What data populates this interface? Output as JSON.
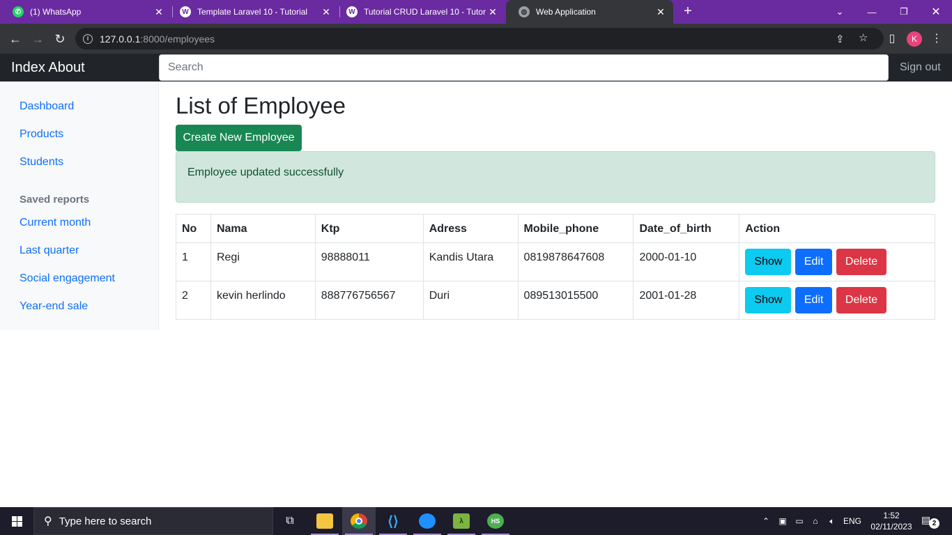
{
  "browser": {
    "tabs": [
      {
        "title": "(1) WhatsApp",
        "icon": "whatsapp-icon",
        "color": "#25d366"
      },
      {
        "title": "Template Laravel 10 - Tutorial",
        "icon": "wordpress-icon",
        "color": "#ffffff"
      },
      {
        "title": "Tutorial CRUD Laravel 10 - Tutor",
        "icon": "wordpress-icon",
        "color": "#ffffff"
      },
      {
        "title": "Web Application",
        "icon": "globe-icon",
        "color": "#9aa0a6",
        "active": true
      }
    ],
    "url_host": "127.0.0.1",
    "url_path": ":8000/employees",
    "profile_initial": "K",
    "tab_strip_color": "#6a2aa0"
  },
  "navbar": {
    "brand": "Index About",
    "search_placeholder": "Search",
    "sign_out": "Sign out"
  },
  "sidebar": {
    "items": [
      "Dashboard",
      "Products",
      "Students"
    ],
    "saved_reports_heading": "Saved reports",
    "reports": [
      "Current month",
      "Last quarter",
      "Social engagement",
      "Year-end sale"
    ]
  },
  "main": {
    "title": "List of Employee",
    "create_button": "Create New Employee",
    "alert": "Employee updated successfully",
    "table": {
      "headers": [
        "No",
        "Nama",
        "Ktp",
        "Adress",
        "Mobile_phone",
        "Date_of_birth",
        "Action"
      ],
      "rows": [
        {
          "no": "1",
          "nama": "Regi",
          "ktp": "98888011",
          "adress": "Kandis Utara",
          "mobile_phone": "0819878647608",
          "date_of_birth": "2000-01-10"
        },
        {
          "no": "2",
          "nama": "kevin herlindo",
          "ktp": "888776756567",
          "adress": "Duri",
          "mobile_phone": "089513015500",
          "date_of_birth": "2001-01-28"
        }
      ],
      "actions": {
        "show": "Show",
        "edit": "Edit",
        "delete": "Delete"
      }
    }
  },
  "taskbar": {
    "search_placeholder": "Type here to search",
    "language": "ENG",
    "time": "1:52",
    "date": "02/11/2023",
    "notification_count": "2"
  }
}
